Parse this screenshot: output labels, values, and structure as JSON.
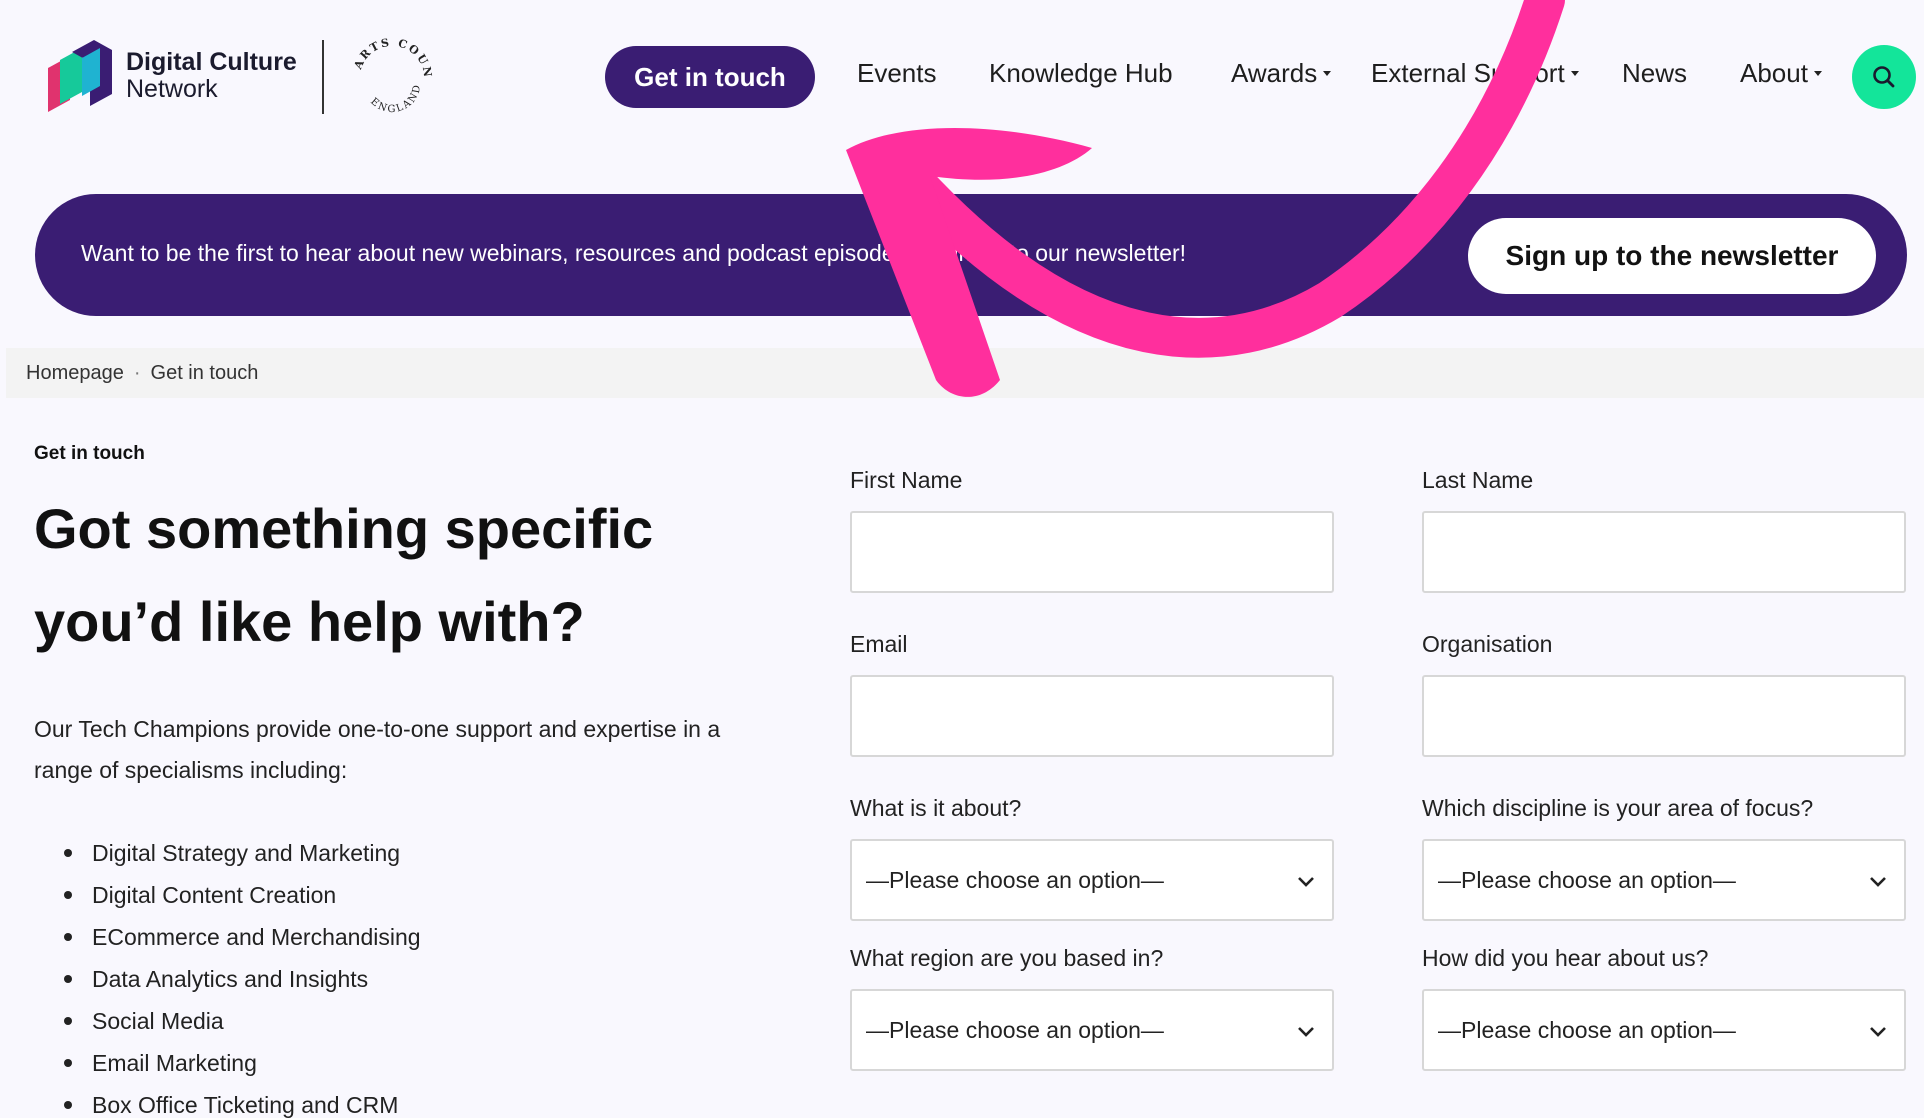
{
  "brand": {
    "name_line1": "Digital Culture",
    "name_line2": "Network",
    "partner_top": "ARTS COUNCIL",
    "partner_bottom": "ENGLAND"
  },
  "nav": {
    "cta": "Get in touch",
    "items": [
      {
        "label": "Events",
        "dropdown": false
      },
      {
        "label": "Knowledge Hub",
        "dropdown": false
      },
      {
        "label": "Awards",
        "dropdown": true
      },
      {
        "label": "External Support",
        "dropdown": true
      },
      {
        "label": "News",
        "dropdown": false
      },
      {
        "label": "About",
        "dropdown": true
      }
    ],
    "search_icon": "search-icon"
  },
  "banner": {
    "text": "Want to be the first to hear about new webinars, resources and podcast episodes? Sign up to our newsletter!",
    "button": "Sign up to the newsletter"
  },
  "breadcrumb": {
    "items": [
      "Homepage",
      "Get in touch"
    ],
    "separator": "·"
  },
  "intro": {
    "eyebrow": "Get in touch",
    "headline": "Got something specific you’d like help with?",
    "body": "Our Tech Champions provide one-to-one support and expertise in a range of specialisms including:",
    "specialisms": [
      "Digital Strategy and Marketing",
      "Digital Content Creation",
      "ECommerce and Merchandising",
      "Data Analytics and Insights",
      "Social Media",
      "Email Marketing",
      "Box Office Ticketing and CRM"
    ]
  },
  "form": {
    "first_name": {
      "label": "First Name",
      "value": ""
    },
    "last_name": {
      "label": "Last Name",
      "value": ""
    },
    "email": {
      "label": "Email",
      "value": ""
    },
    "organisation": {
      "label": "Organisation",
      "value": ""
    },
    "about": {
      "label": "What is it about?",
      "selected": "—Please choose an option—"
    },
    "discipline": {
      "label": "Which discipline is your area of focus?",
      "selected": "—Please choose an option—"
    },
    "region": {
      "label": "What region are you based in?",
      "selected": "—Please choose an option—"
    },
    "heard": {
      "label": "How did you hear about us?",
      "selected": "—Please choose an option—"
    }
  },
  "colors": {
    "brand_purple": "#3a1d73",
    "accent_green": "#13e59a",
    "annotation_pink": "#ff2f9d",
    "page_bg": "#f9f8fe"
  }
}
